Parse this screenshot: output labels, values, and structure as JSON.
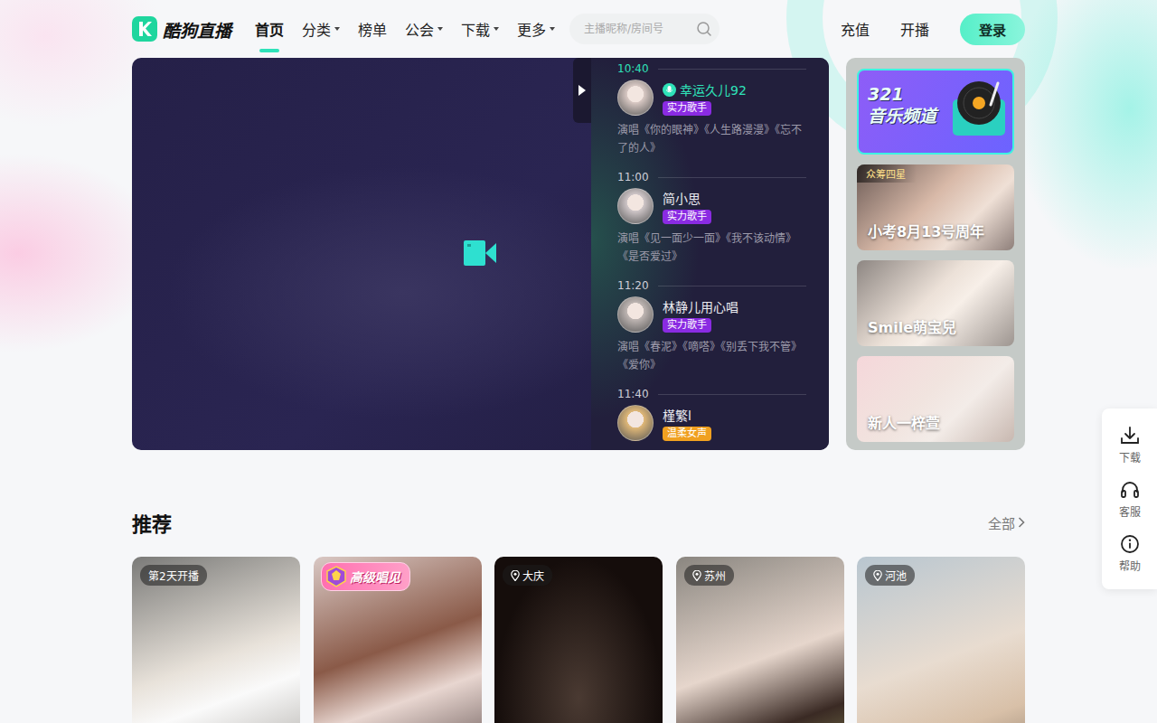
{
  "logo": {
    "text": "酷狗直播"
  },
  "nav": [
    {
      "label": "首页",
      "selected": true,
      "dropdown": false
    },
    {
      "label": "分类",
      "selected": false,
      "dropdown": true
    },
    {
      "label": "榜单",
      "selected": false,
      "dropdown": false
    },
    {
      "label": "公会",
      "selected": false,
      "dropdown": true
    },
    {
      "label": "下载",
      "selected": false,
      "dropdown": true
    },
    {
      "label": "更多",
      "selected": false,
      "dropdown": true
    }
  ],
  "search": {
    "placeholder": "主播昵称/房间号"
  },
  "header_links": [
    "充值",
    "开播"
  ],
  "login_button": "登录",
  "schedule": [
    {
      "time": "10:40",
      "name": "幸运久儿92",
      "tag": "实力歌手",
      "color": "#8a2be2",
      "songs": "演唱《你的眼神》《人生路漫漫》《忘不了的人》",
      "selected": true
    },
    {
      "time": "11:00",
      "name": "简小思",
      "tag": "实力歌手",
      "color": "#8a2be2",
      "songs": "演唱《见一面少一面》《我不该动情》《是否爱过》",
      "selected": false
    },
    {
      "time": "11:20",
      "name": "林静儿用心唱",
      "tag": "实力歌手",
      "color": "#8a2be2",
      "songs": "演唱《春泥》《嘀嗒》《别丢下我不管》《爱你》",
      "selected": false
    },
    {
      "time": "11:40",
      "name": "槿繁l",
      "tag": "温柔女声",
      "color": "#f0a020",
      "selected": false
    }
  ],
  "side_cards": [
    {
      "kind": "banner",
      "lines": [
        "321",
        "音乐频道"
      ],
      "selected": true
    },
    {
      "kind": "photo",
      "badge": "众筹四星",
      "label": "小考8月13号周年",
      "selected": false
    },
    {
      "kind": "photo",
      "label": "Smile萌宝兒",
      "selected": false
    },
    {
      "kind": "photo",
      "label": "新人一梓萱",
      "selected": false
    }
  ],
  "recommend": {
    "title": "推荐",
    "more": "全部",
    "cards": [
      {
        "kind": "text",
        "badge": "第2天开播"
      },
      {
        "kind": "level",
        "badge": "高级唱见"
      },
      {
        "kind": "location",
        "badge": "大庆"
      },
      {
        "kind": "location",
        "badge": "苏州"
      },
      {
        "kind": "location",
        "badge": "河池"
      }
    ]
  },
  "float_bar": [
    {
      "kind": "download",
      "label": "下载"
    },
    {
      "kind": "service",
      "label": "客服"
    },
    {
      "kind": "help",
      "label": "帮助"
    }
  ]
}
